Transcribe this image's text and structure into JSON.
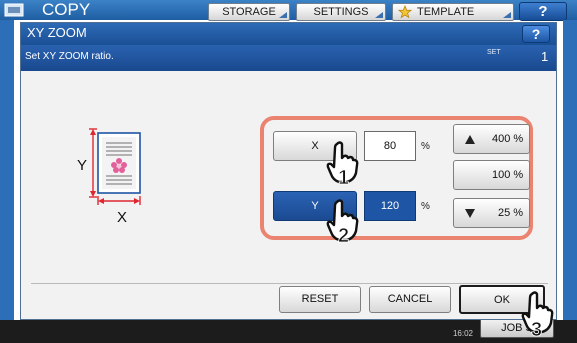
{
  "header": {
    "app_title": "COPY",
    "tabs": [
      {
        "label": "STORAGE"
      },
      {
        "label": "SETTINGS"
      },
      {
        "label": "TEMPLATE"
      }
    ],
    "help_label": "?"
  },
  "dialog": {
    "title": "XY ZOOM",
    "help_label": "?",
    "instruction": "Set XY ZOOM ratio.",
    "set_label": "SET",
    "set_number": "1",
    "diagram": {
      "x_label": "X",
      "y_label": "Y"
    },
    "x_control": {
      "label": "X",
      "value": "80",
      "unit": "%"
    },
    "y_control": {
      "label": "Y",
      "value": "120",
      "unit": "%",
      "selected": true
    },
    "presets": {
      "up_label": "400 %",
      "mid_label": "100 %",
      "down_label": "25 %"
    },
    "footer": {
      "reset_label": "RESET",
      "cancel_label": "CANCEL",
      "ok_label": "OK"
    }
  },
  "status": {
    "time": "16:02",
    "job_status_label": "JOB S"
  },
  "step_markers": [
    "1",
    "2",
    "3"
  ],
  "colors": {
    "accent_blue": "#1e55a4",
    "highlight": "#ea8470"
  }
}
